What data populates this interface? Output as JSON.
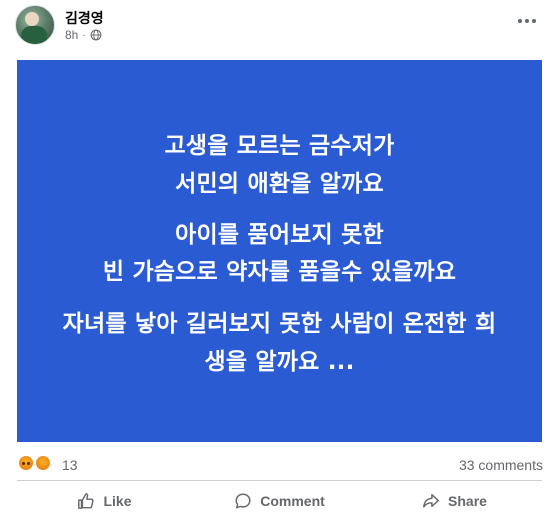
{
  "post": {
    "author": "김경영",
    "time": "8h",
    "privacy_icon": "globe-icon",
    "more_icon": "more-options-icon"
  },
  "image_text": {
    "lines": [
      "고생을 모르는 금수저가",
      "서민의 애환을 알까요",
      "아이를 품어보지 못한",
      "빈 가슴으로 약자를 품을수 있을까요",
      "자녀를 낳아 길러보지 못한 사람이 온전한 희",
      "생을 알까요 ..."
    ],
    "background_color": "#2a5bd2",
    "text_color": "#ffffff"
  },
  "stats": {
    "reaction_icons": [
      "angry-reaction-icon",
      "haha-reaction-icon"
    ],
    "reaction_count": "13",
    "comments": "33 comments"
  },
  "actions": {
    "like": "Like",
    "comment": "Comment",
    "share": "Share"
  }
}
